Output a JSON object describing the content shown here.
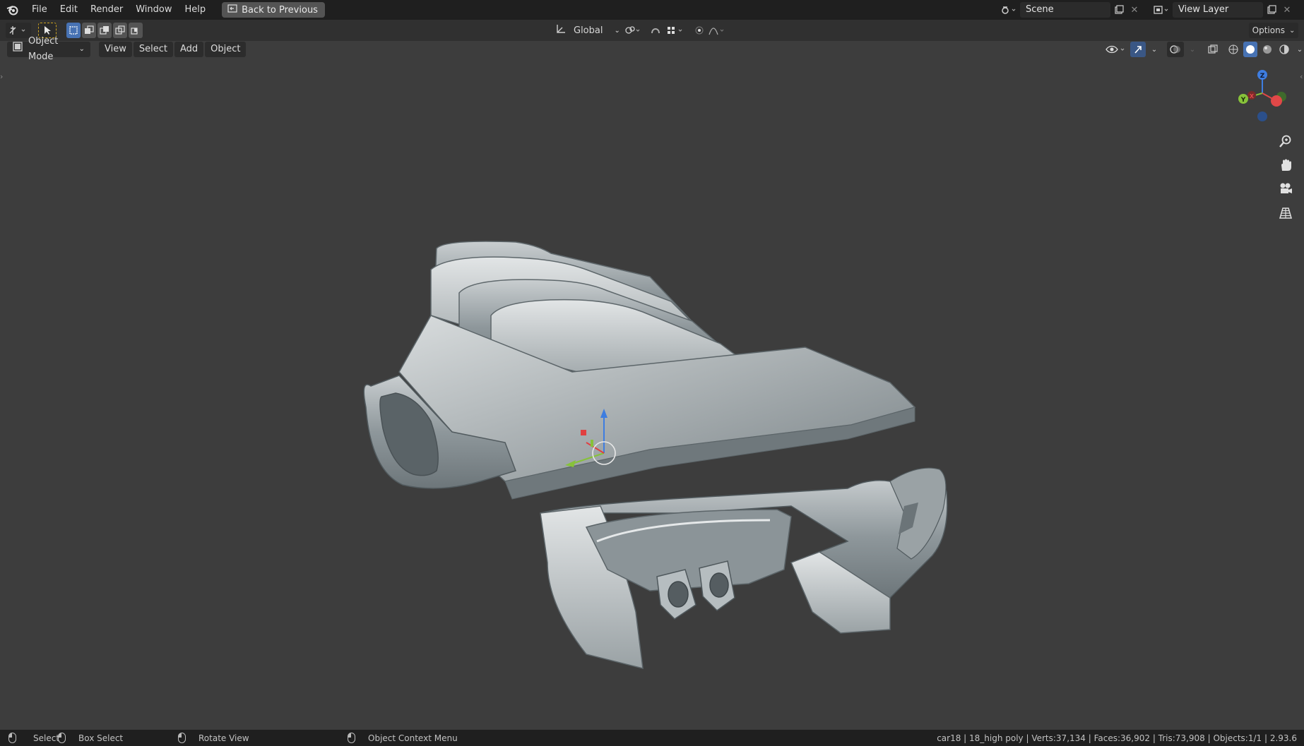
{
  "menu": {
    "items": [
      "File",
      "Edit",
      "Render",
      "Window",
      "Help"
    ]
  },
  "back_button": "Back to Previous",
  "scene": {
    "label": "Scene"
  },
  "view_layer": {
    "label": "View Layer"
  },
  "toolbar": {
    "transform_orientation": "Global",
    "options_label": "Options"
  },
  "header": {
    "mode": "Object Mode",
    "view": "View",
    "select": "Select",
    "add": "Add",
    "object": "Object"
  },
  "gizmo": {
    "z": "Z",
    "y": "Y",
    "x": "X"
  },
  "status": {
    "select": "Select",
    "box_select": "Box Select",
    "rotate_view": "Rotate View",
    "context_menu": "Object Context Menu",
    "stats": "car18 | 18_high poly | Verts:37,134 | Faces:36,902 | Tris:73,908 | Objects:1/1 | 2.93.6"
  },
  "colors": {
    "background": "#3d3d3d",
    "topbar": "#1f1f1f",
    "accent": "#4772b3"
  }
}
